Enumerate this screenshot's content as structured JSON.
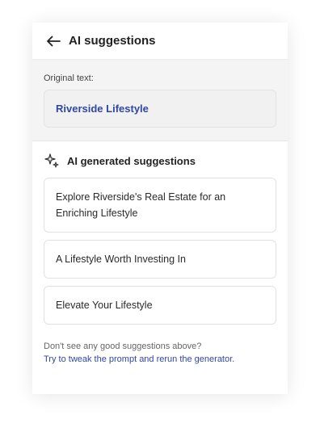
{
  "header": {
    "title": "AI suggestions",
    "back_icon": "arrow-left-icon"
  },
  "original": {
    "label": "Original text:",
    "value": "Riverside Lifestyle"
  },
  "suggestions": {
    "title": "AI generated suggestions",
    "icon": "sparkle-icon",
    "items": [
      {
        "text": "Explore Riverside's Real Estate for an Enriching Lifestyle"
      },
      {
        "text": "A Lifestyle Worth Investing In"
      },
      {
        "text": "Elevate Your Lifestyle"
      }
    ]
  },
  "footer": {
    "text": "Don't see any good suggestions above?",
    "link": "Try to tweak the prompt and rerun the generator."
  },
  "colors": {
    "accent": "#2f47a6",
    "panel_gray": "#f4f4f4"
  }
}
